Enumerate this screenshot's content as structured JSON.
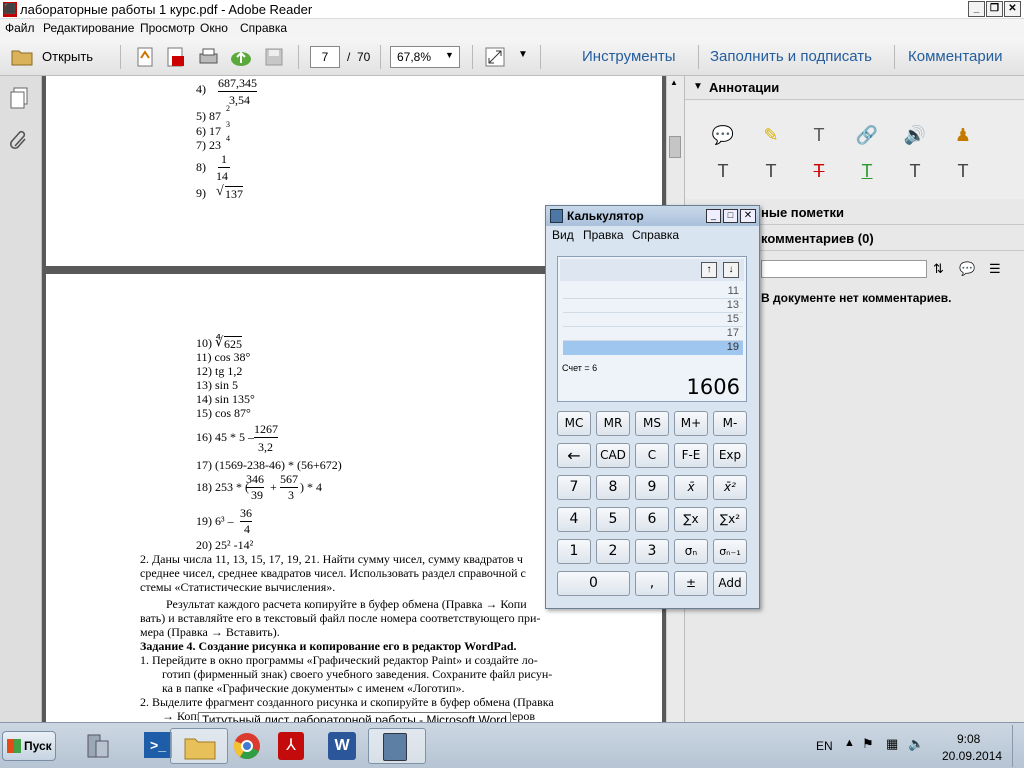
{
  "window": {
    "title": "лабораторные работы 1 курс.pdf - Adobe Reader"
  },
  "menu": [
    "Файл",
    "Редактирование",
    "Просмотр",
    "Окно",
    "Справка"
  ],
  "toolbar": {
    "open": "Открыть",
    "page_current": "7",
    "page_sep": "/",
    "page_total": "70",
    "zoom": "67,8%",
    "tools": "Инструменты",
    "fill_sign": "Заполнить и подписать",
    "comments": "Комментарии"
  },
  "page1": {
    "lines": [
      "4)",
      "687,345",
      "3,54",
      "5)  87",
      "2",
      "6)  17",
      "3",
      "7)  23",
      "4",
      "8)",
      "1",
      "14",
      "9)",
      "137"
    ]
  },
  "page2": {
    "items": [
      "10)",
      "625",
      "11) cos 38°",
      "12) tg 1,2",
      "13) sin  5",
      "14) sin 135°",
      "15) cos 87°",
      "16) 45 * 5 –",
      "1267",
      "3,2",
      "17) (1569-238-46) * (56+672)",
      "18) 253 * (",
      "346",
      "39",
      "+",
      "567",
      "3",
      ") * 4",
      "19) 6³ –",
      "36",
      "4",
      "20) 25² -14²"
    ],
    "para": [
      "2.   Даны числа 11, 13, 15, 17, 19, 21. Найти сумму чисел, сумму квадратов ч",
      "среднее чисел, среднее квадратов чисел. Использовать раздел справочной с",
      "стемы «Статистические вычисления».",
      "Результат каждого расчета копируйте в буфер обмена (Правка  → Копи",
      "вать) и вставляйте его в текстовый файл после  номера  соответствующего при-",
      "мера (Правка  → Вставить).",
      "Задание 4. Создание рисунка и копирование его в редактор WordPad.",
      "1. Перейдите  в окно программы «Графический редактор Paint» и создайте  ло-",
      "готип (фирменный знак) своего учебного заведения. Сохраните файл рисун-",
      "ка в папке «Графические документы» с именем «Логотип».",
      "2. Выделите фрагмент созданного рисунка и скопируйте в буфер обмена (Правка",
      "→ Копи",
      "римеров"
    ]
  },
  "rpanel": {
    "annotations": "Аннотации",
    "drawing": "ные пометки",
    "comments_list": "комментариев (0)",
    "no_comments": "В документе нет комментариев."
  },
  "calc": {
    "title": "Калькулятор",
    "menu": [
      "Вид",
      "Правка",
      "Справка"
    ],
    "list": [
      "11",
      "13",
      "15",
      "17",
      "19"
    ],
    "count": "Счет = 6",
    "display": "1606",
    "buttons": [
      [
        "MC",
        "MR",
        "MS",
        "M+",
        "M-"
      ],
      [
        "←",
        "CAD",
        "C",
        "F-E",
        "Exp"
      ],
      [
        "7",
        "8",
        "9",
        "x̄",
        "x̄²"
      ],
      [
        "4",
        "5",
        "6",
        "∑x",
        "∑x²"
      ],
      [
        "1",
        "2",
        "3",
        "σₙ",
        "σₙ₋₁"
      ],
      [
        "0",
        ",",
        "±",
        "Add"
      ]
    ]
  },
  "taskbar": {
    "start": "Пуск",
    "lang": "EN",
    "time": "9:08",
    "date": "20.09.2014",
    "tooltip": "Титутьный лист лабораторной работы - Microsoft Word"
  }
}
